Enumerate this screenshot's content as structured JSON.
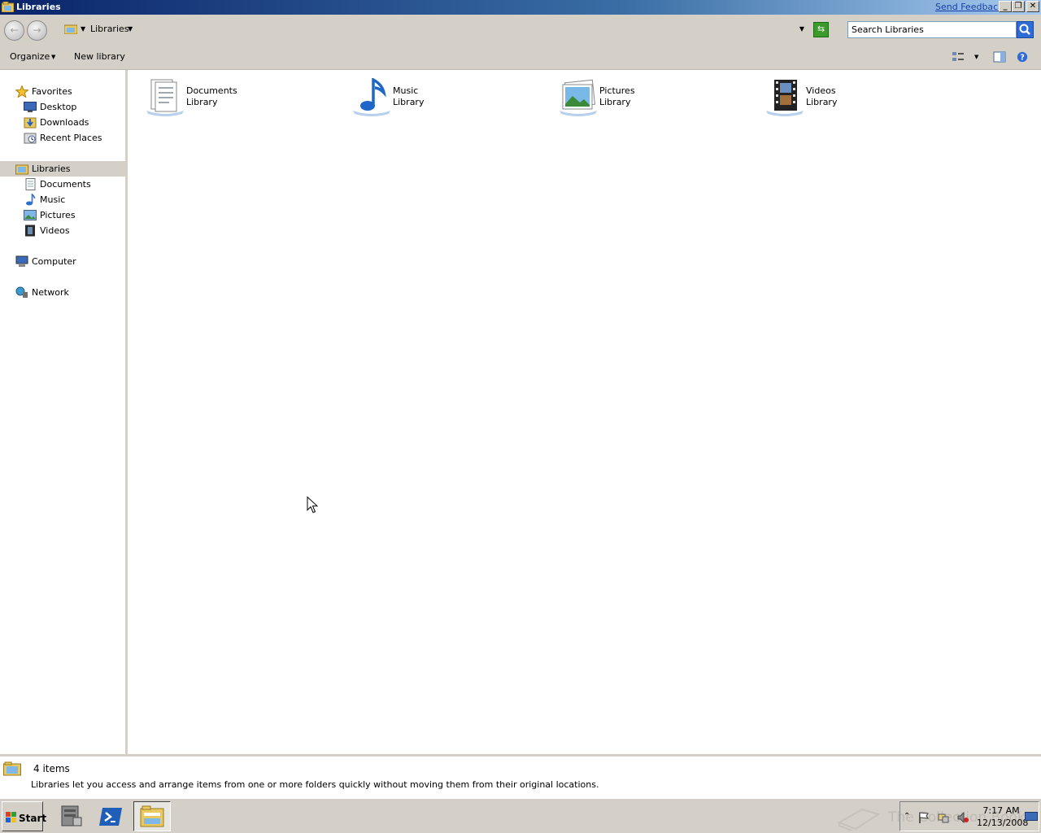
{
  "window": {
    "title": "Libraries",
    "feedback_link": "Send Feedback",
    "minimize_glyph": "_",
    "restore_glyph": "❐",
    "close_glyph": "✕"
  },
  "addressbar": {
    "breadcrumb": "Libraries",
    "search_placeholder": "Search Libraries"
  },
  "toolbar": {
    "organize_label": "Organize",
    "new_library_label": "New library"
  },
  "navpane": {
    "favorites": {
      "label": "Favorites",
      "items": [
        {
          "label": "Desktop",
          "icon": "desktop-icon"
        },
        {
          "label": "Downloads",
          "icon": "downloads-icon"
        },
        {
          "label": "Recent Places",
          "icon": "recent-places-icon"
        }
      ]
    },
    "libraries": {
      "label": "Libraries",
      "items": [
        {
          "label": "Documents",
          "icon": "documents-icon"
        },
        {
          "label": "Music",
          "icon": "music-icon"
        },
        {
          "label": "Pictures",
          "icon": "pictures-icon"
        },
        {
          "label": "Videos",
          "icon": "videos-icon"
        }
      ]
    },
    "computer_label": "Computer",
    "network_label": "Network"
  },
  "content": {
    "libraries": [
      {
        "name": "Documents",
        "type": "Library",
        "icon": "documents-library-icon"
      },
      {
        "name": "Music",
        "type": "Library",
        "icon": "music-library-icon"
      },
      {
        "name": "Pictures",
        "type": "Library",
        "icon": "pictures-library-icon"
      },
      {
        "name": "Videos",
        "type": "Library",
        "icon": "videos-library-icon"
      }
    ]
  },
  "details": {
    "item_count": "4 items",
    "description": "Libraries let you access and arrange items from one or more folders quickly without moving them from their original locations."
  },
  "taskbar": {
    "start_label": "Start",
    "time": "7:17 AM",
    "date": "12/13/2008",
    "watermark": "The Collection Book"
  },
  "colors": {
    "titlebar_start": "#0a246a",
    "titlebar_end": "#a6caf0",
    "chrome": "#d4d0c8",
    "selection": "#d4d0c8"
  }
}
